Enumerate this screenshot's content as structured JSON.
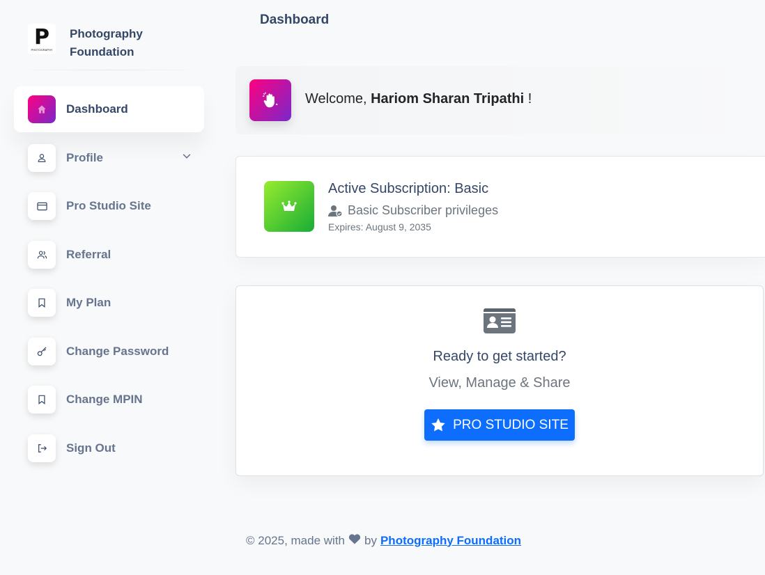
{
  "brand": {
    "logo_letter": "P",
    "logo_caption": "PHOTOGRAPHY",
    "name_line1": "Photography",
    "name_line2": "Foundation"
  },
  "sidebar": {
    "items": [
      {
        "label": "Dashboard",
        "icon": "home-icon",
        "active": true
      },
      {
        "label": "Profile",
        "icon": "user-icon",
        "has_submenu": true
      },
      {
        "label": "Pro Studio Site",
        "icon": "credit-card-icon"
      },
      {
        "label": "Referral",
        "icon": "users-icon"
      },
      {
        "label": "My Plan",
        "icon": "bookmark-icon"
      },
      {
        "label": "Change Password",
        "icon": "key-icon"
      },
      {
        "label": "Change MPIN",
        "icon": "bookmark-icon"
      },
      {
        "label": "Sign Out",
        "icon": "sign-out-icon"
      }
    ]
  },
  "header": {
    "title": "Dashboard"
  },
  "welcome": {
    "prefix": "Welcome,",
    "name": "Hariom Sharan Tripathi",
    "suffix": "!"
  },
  "subscription": {
    "title": "Active Subscription: Basic",
    "privileges": "Basic Subscriber privileges",
    "expires": "Expires: August 9, 2035"
  },
  "start": {
    "heading": "Ready to get started?",
    "subheading": "View, Manage & Share",
    "button_label": "PRO STUDIO SITE"
  },
  "footer": {
    "prefix": "© 2025, made with",
    "by": "by",
    "link_text": "Photography Foundation"
  },
  "colors": {
    "accent_gradient_start": "#7928ca",
    "accent_gradient_end": "#ff0080",
    "success_gradient_start": "#98ec2d",
    "success_gradient_end": "#17ad37",
    "primary": "#0d6efd"
  }
}
